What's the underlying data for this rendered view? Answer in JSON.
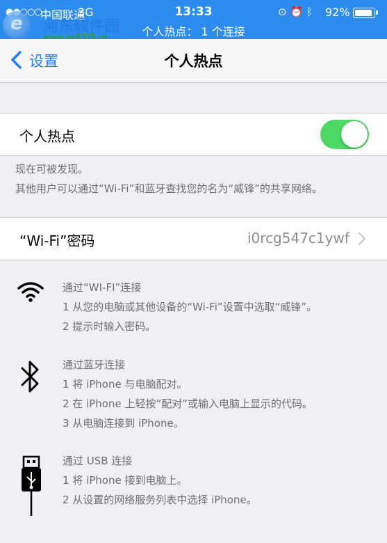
{
  "status_bar": {
    "signal": "●●○○○",
    "carrier": "中国联通",
    "network": "3G",
    "time": "13:33",
    "icons": [
      "lock-rotation-icon",
      "alarm-icon",
      "bluetooth-icon"
    ],
    "battery_percent": "92%",
    "battery_level": 0.92,
    "hotspot_status": "个人热点： 1 个连接",
    "color": "#2d8cf0"
  },
  "watermark": {
    "name": "河东软件园",
    "url": "www.pc0359.cn"
  },
  "nav": {
    "back_label": "设置",
    "title": "个人热点"
  },
  "hotspot": {
    "label": "个人热点",
    "enabled": true,
    "toggle_color": "#4cd964",
    "footnote_line1": "现在可被发现。",
    "footnote_line2": "其他用户可以通过“Wi-Fi”和蓝牙查找您的名为“威锋”的共享网络。"
  },
  "wifi_password": {
    "label": "“Wi-Fi”密码",
    "value": "i0rcg547c1ywf"
  },
  "instructions": {
    "wifi": {
      "icon": "wifi-icon",
      "title": "通过“WI-FI”连接",
      "steps": [
        "1 从您的电脑或其他设备的“Wi-Fi”设置中选取“威锋”。",
        "2 提示时输入密码。"
      ]
    },
    "bluetooth": {
      "icon": "bluetooth-icon",
      "title": "通过蓝牙连接",
      "steps": [
        "1 将 iPhone 与电脑配对。",
        "2 在 iPhone 上轻按“配对”或输入电脑上显示的代码。",
        "3 从电脑连接到 iPhone。"
      ]
    },
    "usb": {
      "icon": "usb-icon",
      "title": "通过 USB 连接",
      "steps": [
        "1 将 iPhone 接到电脑上。",
        "2 从设置的网络服务列表中选择 iPhone。"
      ]
    }
  }
}
